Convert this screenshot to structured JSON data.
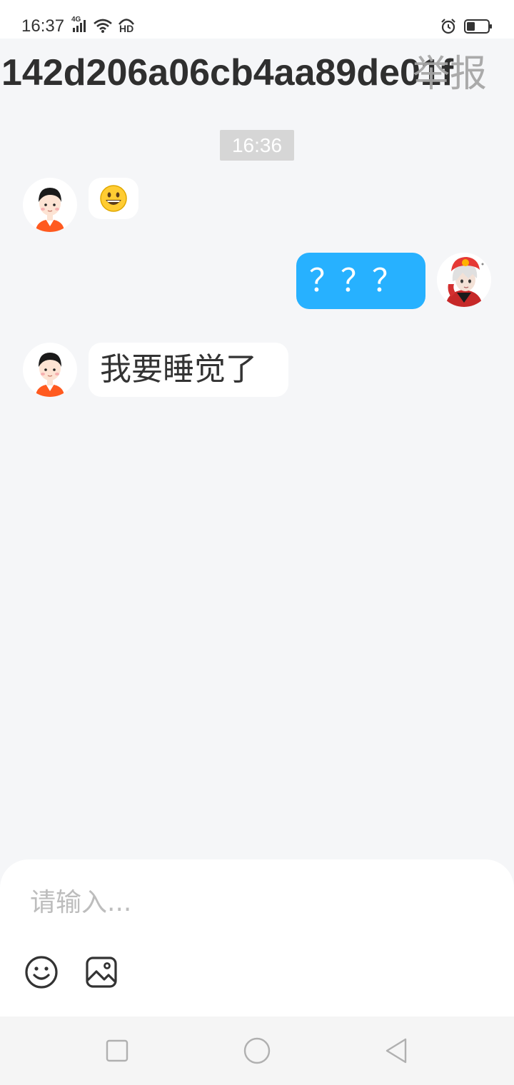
{
  "status_bar": {
    "time": "16:37",
    "network_label": "4G",
    "hd_label": "HD",
    "icons": [
      "signal-icon",
      "wifi-icon",
      "hd-call-icon",
      "alarm-icon",
      "battery-icon"
    ]
  },
  "header": {
    "title": "142d206a06cb4aa89de01f",
    "report_label": "举报"
  },
  "chat": {
    "timestamp": "16:36",
    "messages": [
      {
        "side": "incoming",
        "type": "emoji",
        "content": "😃"
      },
      {
        "side": "outgoing",
        "type": "text",
        "content": "？？？"
      },
      {
        "side": "incoming",
        "type": "text",
        "content": "我要睡觉了"
      }
    ]
  },
  "input": {
    "placeholder": "请输入...",
    "tools": [
      "emoji-icon",
      "image-icon"
    ]
  },
  "nav": {
    "buttons": [
      "recent-apps",
      "home",
      "back"
    ]
  },
  "colors": {
    "background": "#f5f6f8",
    "outgoing_bubble": "#27b1ff",
    "incoming_bubble": "#ffffff",
    "timestamp_bg": "#d6d6d6"
  }
}
